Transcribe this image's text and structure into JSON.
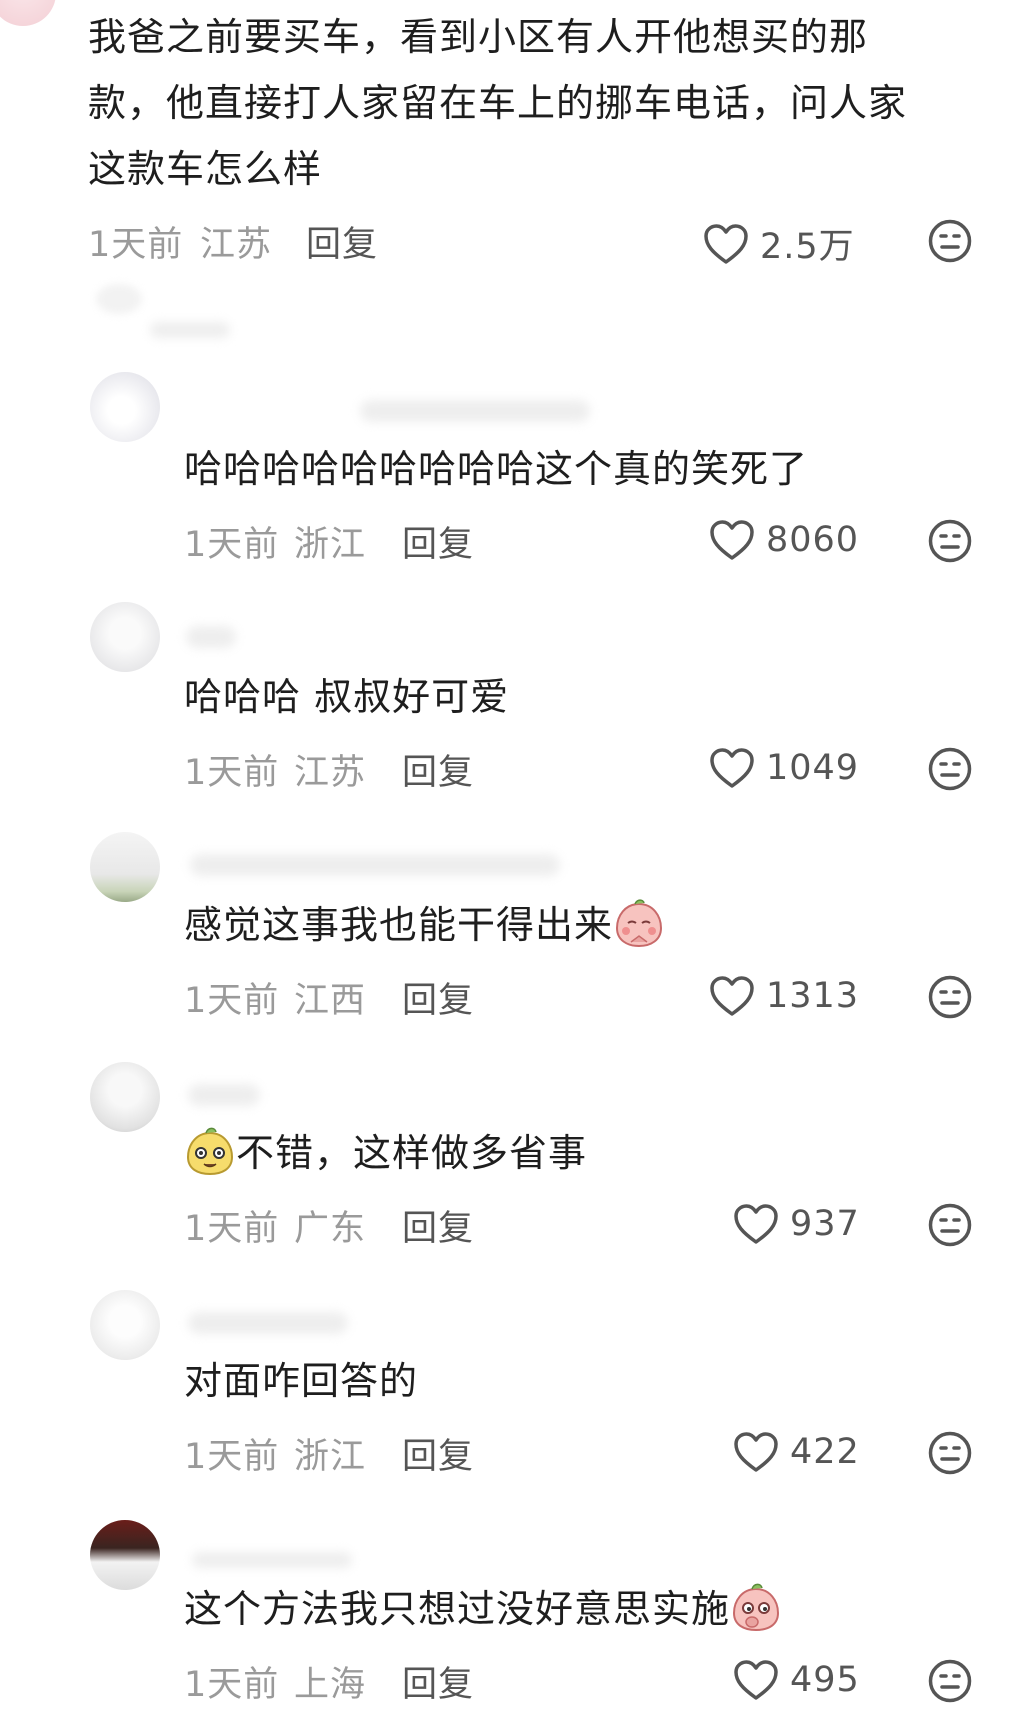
{
  "comments": [
    {
      "text_lines": [
        "我爸之前要买车，看到小区有人开他想买的那",
        "款，他直接打人家留在车上的挪车电话，问人家",
        "这款车怎么样"
      ],
      "time": "1天前",
      "location": "江苏",
      "reply": "回复",
      "likes": "2.5万"
    },
    {
      "text": "哈哈哈哈哈哈哈哈哈这个真的笑死了",
      "time": "1天前",
      "location": "浙江",
      "reply": "回复",
      "likes": "8060"
    },
    {
      "text": "哈哈哈 叔叔好可爱",
      "time": "1天前",
      "location": "江苏",
      "reply": "回复",
      "likes": "1049"
    },
    {
      "text": "感觉这事我也能干得出来",
      "time": "1天前",
      "location": "江西",
      "reply": "回复",
      "likes": "1313"
    },
    {
      "text": "不错，这样做多省事",
      "time": "1天前",
      "location": "广东",
      "reply": "回复",
      "likes": "937"
    },
    {
      "text": "对面咋回答的",
      "time": "1天前",
      "location": "浙江",
      "reply": "回复",
      "likes": "422"
    },
    {
      "text": "这个方法我只想过没好意思实施",
      "time": "1天前",
      "location": "上海",
      "reply": "回复",
      "likes": "495"
    }
  ],
  "icons": {
    "like": "heart-outline-icon",
    "dislike": "meh-face-icon"
  },
  "colors": {
    "text": "#1e1e1e",
    "meta": "#9a9a9a",
    "icon": "#555555",
    "background": "#ffffff"
  }
}
